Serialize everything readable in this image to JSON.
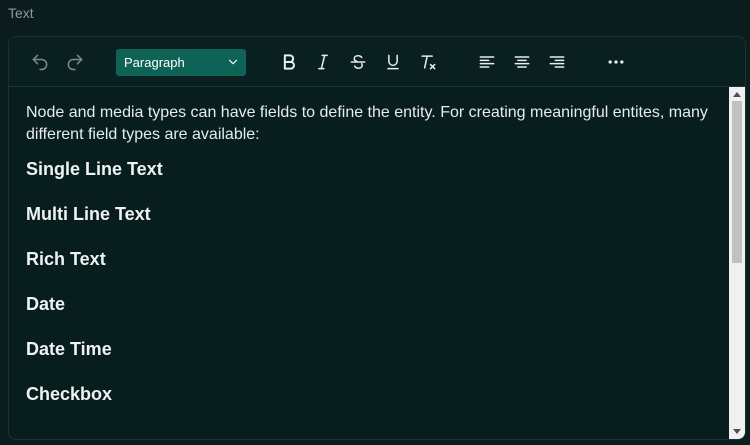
{
  "field": {
    "label": "Text"
  },
  "toolbar": {
    "block_format": "Paragraph",
    "undo": "undo",
    "redo": "redo",
    "bold": "bold",
    "italic": "italic",
    "strikethrough": "strikethrough",
    "underline": "underline",
    "clear_format": "clear formatting",
    "align_left": "align left",
    "align_center": "align center",
    "align_right": "align right",
    "more": "more"
  },
  "content": {
    "intro": "Node and media types can have fields to define the entity. For creating meaningful entites, many different field types are available:",
    "headings": [
      "Single Line Text",
      "Multi Line Text",
      "Rich Text",
      "Date",
      "Date Time",
      "Checkbox"
    ]
  },
  "colors": {
    "background": "#0b1c1c",
    "editor_bg": "#081e1e",
    "accent": "#0e6356",
    "text": "#e6ecec"
  }
}
